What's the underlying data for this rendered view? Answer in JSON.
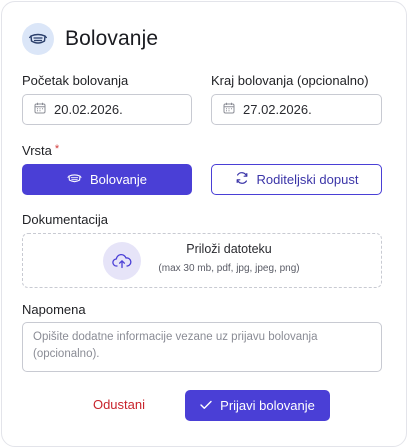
{
  "dialog": {
    "title": "Bolovanje",
    "icon": "mask-icon"
  },
  "start_date": {
    "label": "Početak bolovanja",
    "value": "20.02.2026.",
    "icon": "calendar-icon"
  },
  "end_date": {
    "label": "Kraj bolovanja (opcionalno)",
    "value": "27.02.2026.",
    "icon": "calendar-icon"
  },
  "type": {
    "label": "Vrsta",
    "required_mark": "*",
    "options": [
      {
        "label": "Bolovanje",
        "icon": "mask-icon",
        "selected": true
      },
      {
        "label": "Roditeljski dopust",
        "icon": "cycle-icon",
        "selected": false
      }
    ]
  },
  "documentation": {
    "label": "Dokumentacija",
    "upload_title": "Priloži datoteku",
    "upload_hint": "(max 30 mb, pdf, jpg, jpeg, png)",
    "icon": "cloud-upload-icon"
  },
  "note": {
    "label": "Napomena",
    "placeholder": "Opišite dodatne informacije vezane uz prijavu bolovanja (opcionalno)."
  },
  "actions": {
    "cancel": "Odustani",
    "submit": "Prijavi bolovanje",
    "submit_icon": "check-icon"
  },
  "colors": {
    "primary": "#4a3fd6",
    "danger": "#c8242c",
    "icon_bg": "#dbe6f8"
  }
}
